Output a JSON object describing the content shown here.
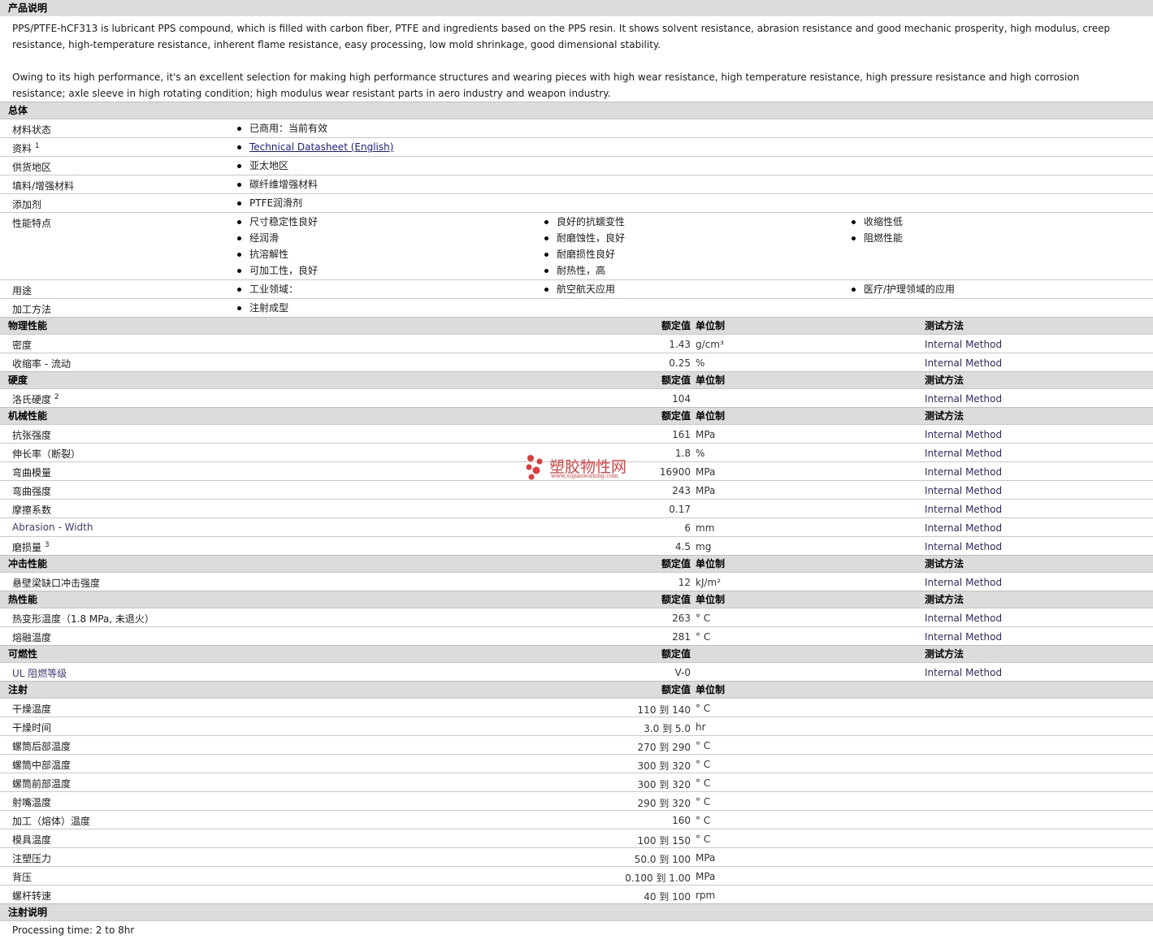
{
  "description": {
    "header": "产品说明",
    "p1": "PPS/PTFE-hCF313 is lubricant PPS compound, which is filled with carbon fiber, PTFE and ingredients based on the PPS resin. It shows solvent resistance, abrasion resistance and good mechanic prosperity, high modulus, creep resistance, high-temperature resistance, inherent flame resistance, easy processing, low mold shrinkage, good dimensional stability.",
    "p2": "Owing to its high performance, it's an excellent selection for making high performance structures and wearing pieces with high wear resistance, high temperature resistance, high pressure resistance and high corrosion resistance; axle sleeve in high rotating condition; high modulus wear resistant parts in aero industry and weapon industry."
  },
  "general": {
    "header": "总体",
    "rows": [
      {
        "label": "材料状态",
        "value": "已商用：当前有效"
      },
      {
        "label": "资料",
        "sup": "1",
        "link": "Technical Datasheet (English)"
      },
      {
        "label": "供货地区",
        "value": "亚太地区"
      },
      {
        "label": "填料/增强材料",
        "value": "碳纤维增强材料"
      },
      {
        "label": "添加剂",
        "value": "PTFE润滑剂"
      }
    ],
    "features": {
      "label": "性能特点",
      "col1": [
        "尺寸稳定性良好",
        "经润滑",
        "抗溶解性",
        "可加工性，良好"
      ],
      "col2": [
        "良好的抗蠕变性",
        "耐磨蚀性，良好",
        "耐磨损性良好",
        "耐热性，高"
      ],
      "col3": [
        "收缩性低",
        "阻燃性能"
      ]
    },
    "uses": {
      "label": "用途",
      "col1": [
        "工业领域："
      ],
      "col2": [
        "航空航天应用"
      ],
      "col3": [
        "医疗/护理领域的应用"
      ]
    },
    "processing": {
      "label": "加工方法",
      "value": "注射成型"
    }
  },
  "columns": {
    "value": "额定值",
    "unit": "单位制",
    "method": "测试方法"
  },
  "physical": {
    "header": "物理性能",
    "rows": [
      {
        "label": "密度",
        "value": "1.43",
        "unit": "g/cm³",
        "method": "Internal Method"
      },
      {
        "label": "收缩率 - 流动",
        "value": "0.25",
        "unit": "%",
        "method": "Internal Method"
      }
    ]
  },
  "hardness": {
    "header": "硬度",
    "rows": [
      {
        "label": "洛氏硬度",
        "sup": "2",
        "value": "104",
        "unit": "",
        "method": "Internal Method"
      }
    ]
  },
  "mechanical": {
    "header": "机械性能",
    "rows": [
      {
        "label": "抗张强度",
        "value": "161",
        "unit": "MPa",
        "method": "Internal Method"
      },
      {
        "label": "伸长率（断裂）",
        "value": "1.8",
        "unit": "%",
        "method": "Internal Method"
      },
      {
        "label": "弯曲模量",
        "value": "16900",
        "unit": "MPa",
        "method": "Internal Method"
      },
      {
        "label": "弯曲强度",
        "value": "243",
        "unit": "MPa",
        "method": "Internal Method"
      },
      {
        "label": "摩擦系数",
        "value": "0.17",
        "unit": "",
        "method": "Internal Method"
      },
      {
        "label": "Abrasion - Width",
        "value": "6",
        "unit": "mm",
        "method": "Internal Method"
      },
      {
        "label": "磨损量",
        "sup": "3",
        "value": "4.5",
        "unit": "mg",
        "method": "Internal Method"
      }
    ]
  },
  "impact": {
    "header": "冲击性能",
    "rows": [
      {
        "label": "悬壁梁缺口冲击强度",
        "value": "12",
        "unit": "kJ/m²",
        "method": "Internal Method"
      }
    ]
  },
  "thermal": {
    "header": "热性能",
    "rows": [
      {
        "label": "热变形温度（1.8 MPa, 未退火）",
        "value": "263",
        "unit": "° C",
        "method": "Internal Method"
      },
      {
        "label": "熔融温度",
        "value": "281",
        "unit": "° C",
        "method": "Internal Method"
      }
    ]
  },
  "flammability": {
    "header": "可燃性",
    "rows": [
      {
        "label": "UL 阻燃等级",
        "value": "V-0",
        "unit": "",
        "method": "Internal Method"
      }
    ]
  },
  "injection": {
    "header": "注射",
    "rows": [
      {
        "label": "干燥温度",
        "value": "110 到  140",
        "unit": "° C"
      },
      {
        "label": "干燥时间",
        "value": "3.0 到  5.0",
        "unit": "hr"
      },
      {
        "label": "螺筒后部温度",
        "value": "270 到  290",
        "unit": "° C"
      },
      {
        "label": "螺筒中部温度",
        "value": "300 到  320",
        "unit": "° C"
      },
      {
        "label": "螺筒前部温度",
        "value": "300 到  320",
        "unit": "° C"
      },
      {
        "label": "射嘴温度",
        "value": "290 到  320",
        "unit": "° C"
      },
      {
        "label": "加工（熔体）温度",
        "value": "160",
        "unit": "° C"
      },
      {
        "label": "模具温度",
        "value": "100 到  150",
        "unit": "° C"
      },
      {
        "label": "注塑压力",
        "value": "50.0 到  100",
        "unit": "MPa"
      },
      {
        "label": "背压",
        "value": "0.100 到  1.00",
        "unit": "MPa"
      },
      {
        "label": "螺杆转速",
        "value": "40 到  100",
        "unit": "rpm"
      }
    ]
  },
  "injection_notes": {
    "header": "注射说明",
    "text": "Processing time: 2 to 8hr"
  },
  "watermark": {
    "text": "塑胶物性网",
    "sub": "www.sujiaowuxing.com"
  }
}
